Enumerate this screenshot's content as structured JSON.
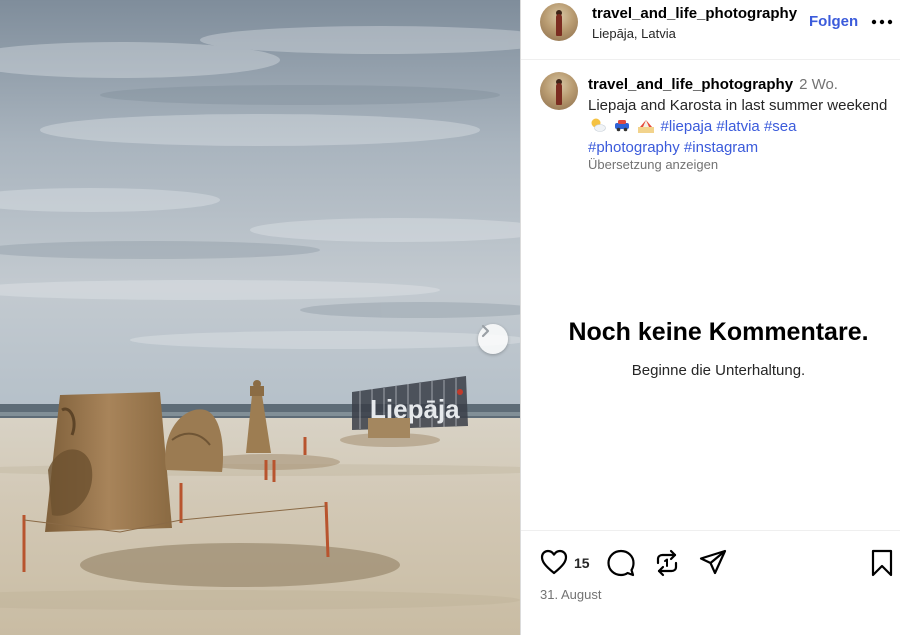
{
  "post": {
    "username": "travel_and_life_photography",
    "location": "Liepāja, Latvia",
    "follow_label": "Folgen",
    "more_label": "•••"
  },
  "caption": {
    "username": "travel_and_life_photography",
    "time": "2 Wo.",
    "text": "Liepaja and Karosta in last summer weekend",
    "emojis": [
      "sun-behind-cloud-emoji",
      "car-emoji",
      "beach-emoji"
    ],
    "hashtags": [
      "#liepaja",
      "#latvia",
      "#sea",
      "#photography",
      "#instagram"
    ],
    "translate_label": "Übersetzung anzeigen"
  },
  "comments": {
    "empty_title": "Noch keine Kommentare.",
    "empty_subtitle": "Beginne die Unterhaltung."
  },
  "actions": {
    "like_count": "15",
    "date": "31. August",
    "icons": [
      "heart-icon",
      "comment-icon",
      "repost-icon",
      "share-icon",
      "bookmark-icon"
    ]
  },
  "photo": {
    "sign_text": "Liepāja",
    "next_icon": "chevron-right-icon"
  },
  "colors": {
    "link": "#3b5bdb",
    "muted": "#737373",
    "sand": "#cfc2a8",
    "sculpture": "#9c7a4e"
  }
}
